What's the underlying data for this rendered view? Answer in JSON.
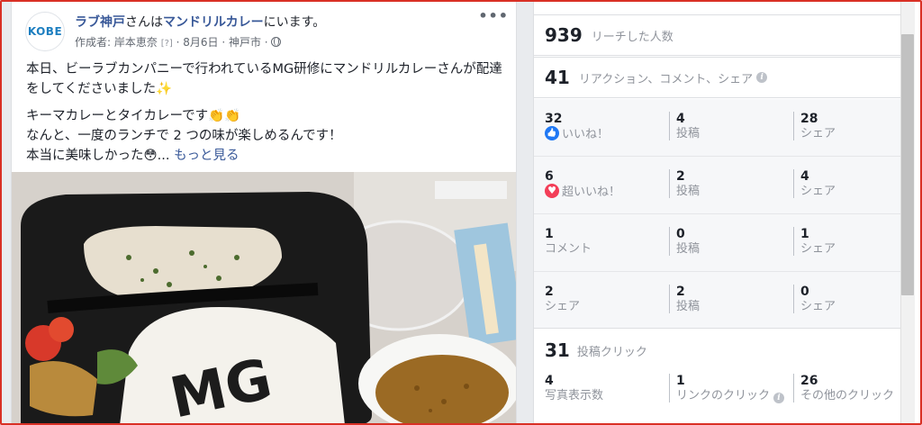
{
  "post": {
    "avatar_text": "KOBE",
    "page_name": "ラブ神戸",
    "title_mid": "さんは",
    "place": "マンドリルカレー",
    "title_end": "にいます。",
    "meta_author": "作成者: 岸本恵奈",
    "meta_help": "[?]",
    "meta_date": "· 8月6日 · 神戸市 ·",
    "more_label": "•••",
    "text_line1": "本日、ビーラブカンパニーで行われているMG研修にマンドリルカレーさんが配達をしてくださいました✨",
    "text_line2": "キーマカレーとタイカレーです👏👏",
    "text_line3": "なんと、一度のランチで 2 つの味が楽しめるんです！",
    "text_line4": "本当に美味しかった😳...",
    "see_more": "もっと見る",
    "photo_text": "MG"
  },
  "insights": {
    "reach_num": "939",
    "reach_label": "リーチした人数",
    "engage_num": "41",
    "engage_label": "リアクション、コメント、シェア",
    "rows": [
      {
        "c0_num": "32",
        "c0_label": "いいね！",
        "c1_num": "4",
        "c1_label": "投稿",
        "c2_num": "28",
        "c2_label": "シェア"
      },
      {
        "c0_num": "6",
        "c0_label": "超いいね！",
        "c1_num": "2",
        "c1_label": "投稿",
        "c2_num": "4",
        "c2_label": "シェア"
      },
      {
        "c0_num": "1",
        "c0_label": "コメント",
        "c1_num": "0",
        "c1_label": "投稿",
        "c2_num": "1",
        "c2_label": "シェア"
      },
      {
        "c0_num": "2",
        "c0_label": "シェア",
        "c1_num": "2",
        "c1_label": "投稿",
        "c2_num": "0",
        "c2_label": "シェア"
      }
    ],
    "clicks_num": "31",
    "clicks_label": "投稿クリック",
    "clicks": {
      "c0_num": "4",
      "c0_label": "写真表示数",
      "c1_num": "1",
      "c1_label": "リンクのクリック",
      "c2_num": "26",
      "c2_label": "その他のクリック"
    }
  },
  "colors": {
    "link": "#385898",
    "like": "#2078f4",
    "love": "#f33e58",
    "frame": "#d93025"
  }
}
